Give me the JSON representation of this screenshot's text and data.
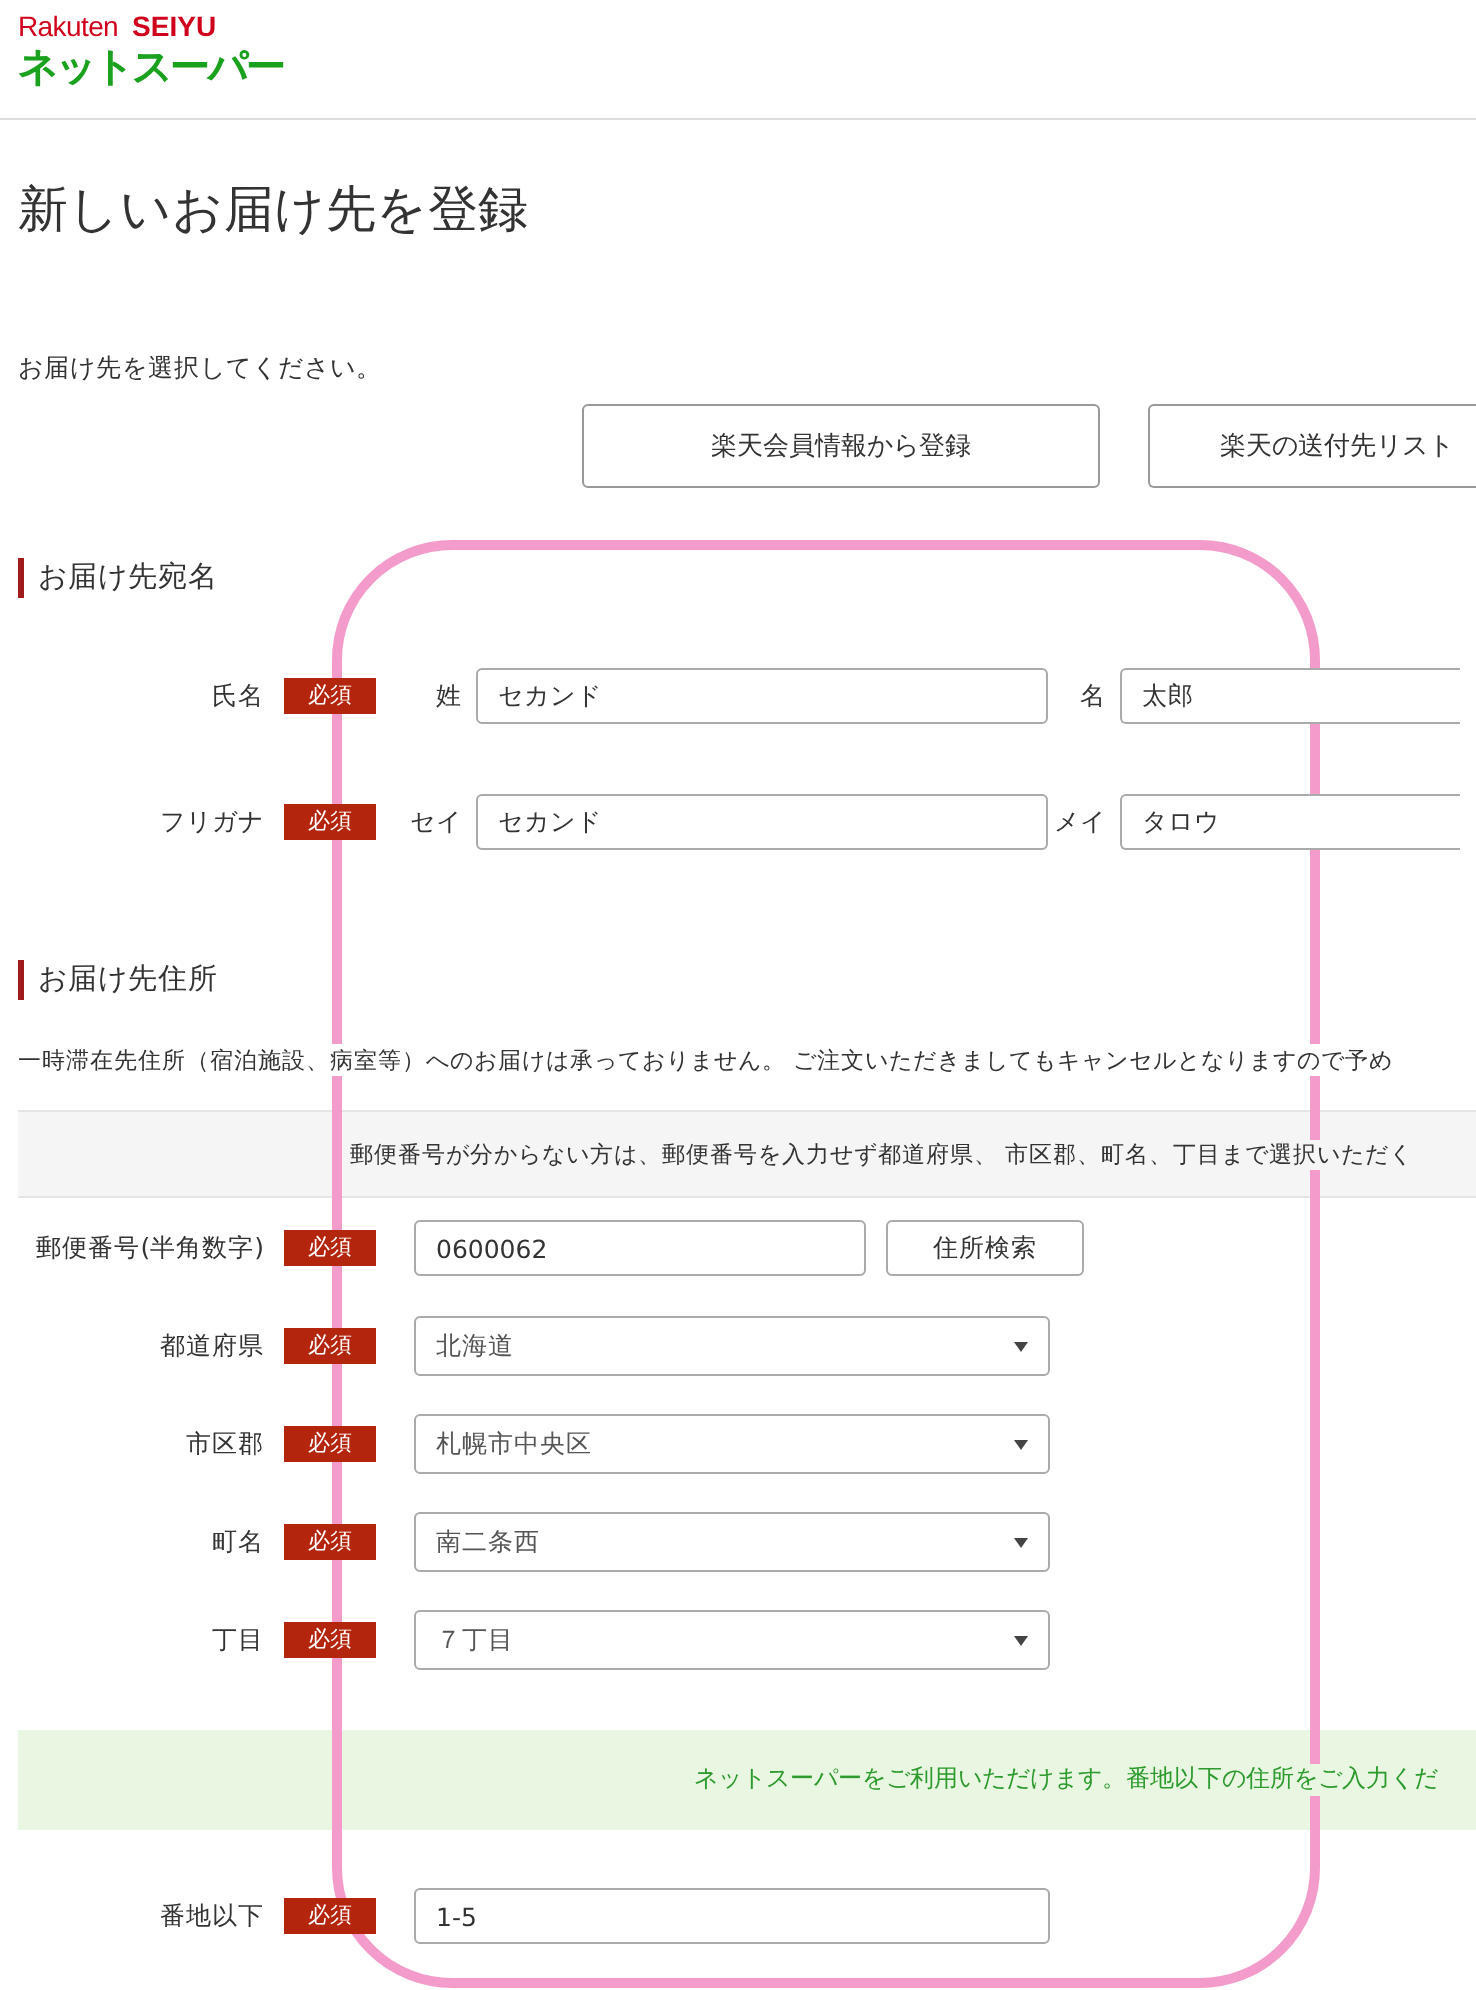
{
  "logo": {
    "brand": "Rakuten",
    "store": "SEIYU",
    "service": "ネットスーパー"
  },
  "title": "新しいお届け先を登録",
  "instruction": "お届け先を選択してください。",
  "source_buttons": [
    "楽天会員情報から登録",
    "楽天の送付先リスト"
  ],
  "name_section": {
    "heading": "お届け先宛名",
    "rows": [
      {
        "label": "氏名",
        "badge": "必須",
        "fields": [
          {
            "label": "姓",
            "value": "セカンド"
          },
          {
            "label": "名",
            "value": "太郎"
          }
        ]
      },
      {
        "label": "フリガナ",
        "badge": "必須",
        "fields": [
          {
            "label": "セイ",
            "value": "セカンド"
          },
          {
            "label": "メイ",
            "value": "タロウ"
          }
        ]
      }
    ]
  },
  "address_section": {
    "heading": "お届け先住所",
    "notice": "一時滞在先住所（宿泊施設、病室等）へのお届けは承っておりません。 ご注文いただきましてもキャンセルとなりますので予め",
    "hint": "郵便番号が分からない方は、郵便番号を入力せず都道府県、 市区郡、町名、丁目まで選択いただく",
    "rows": [
      {
        "kind": "postal",
        "label": "郵便番号(半角数字)",
        "badge": "必須",
        "value": "0600062",
        "button": "住所検索"
      },
      {
        "kind": "select",
        "label": "都道府県",
        "badge": "必須",
        "value": "北海道"
      },
      {
        "kind": "select",
        "label": "市区郡",
        "badge": "必須",
        "value": "札幌市中央区"
      },
      {
        "kind": "select",
        "label": "町名",
        "badge": "必須",
        "value": "南二条西"
      },
      {
        "kind": "select",
        "label": "丁目",
        "badge": "必須",
        "value": "７丁目"
      },
      {
        "kind": "message",
        "text": "ネットスーパーをご利用いただけます。番地以下の住所をご入力くだ"
      },
      {
        "kind": "text",
        "label": "番地以下",
        "badge": "必須",
        "value": "1-5"
      }
    ]
  }
}
